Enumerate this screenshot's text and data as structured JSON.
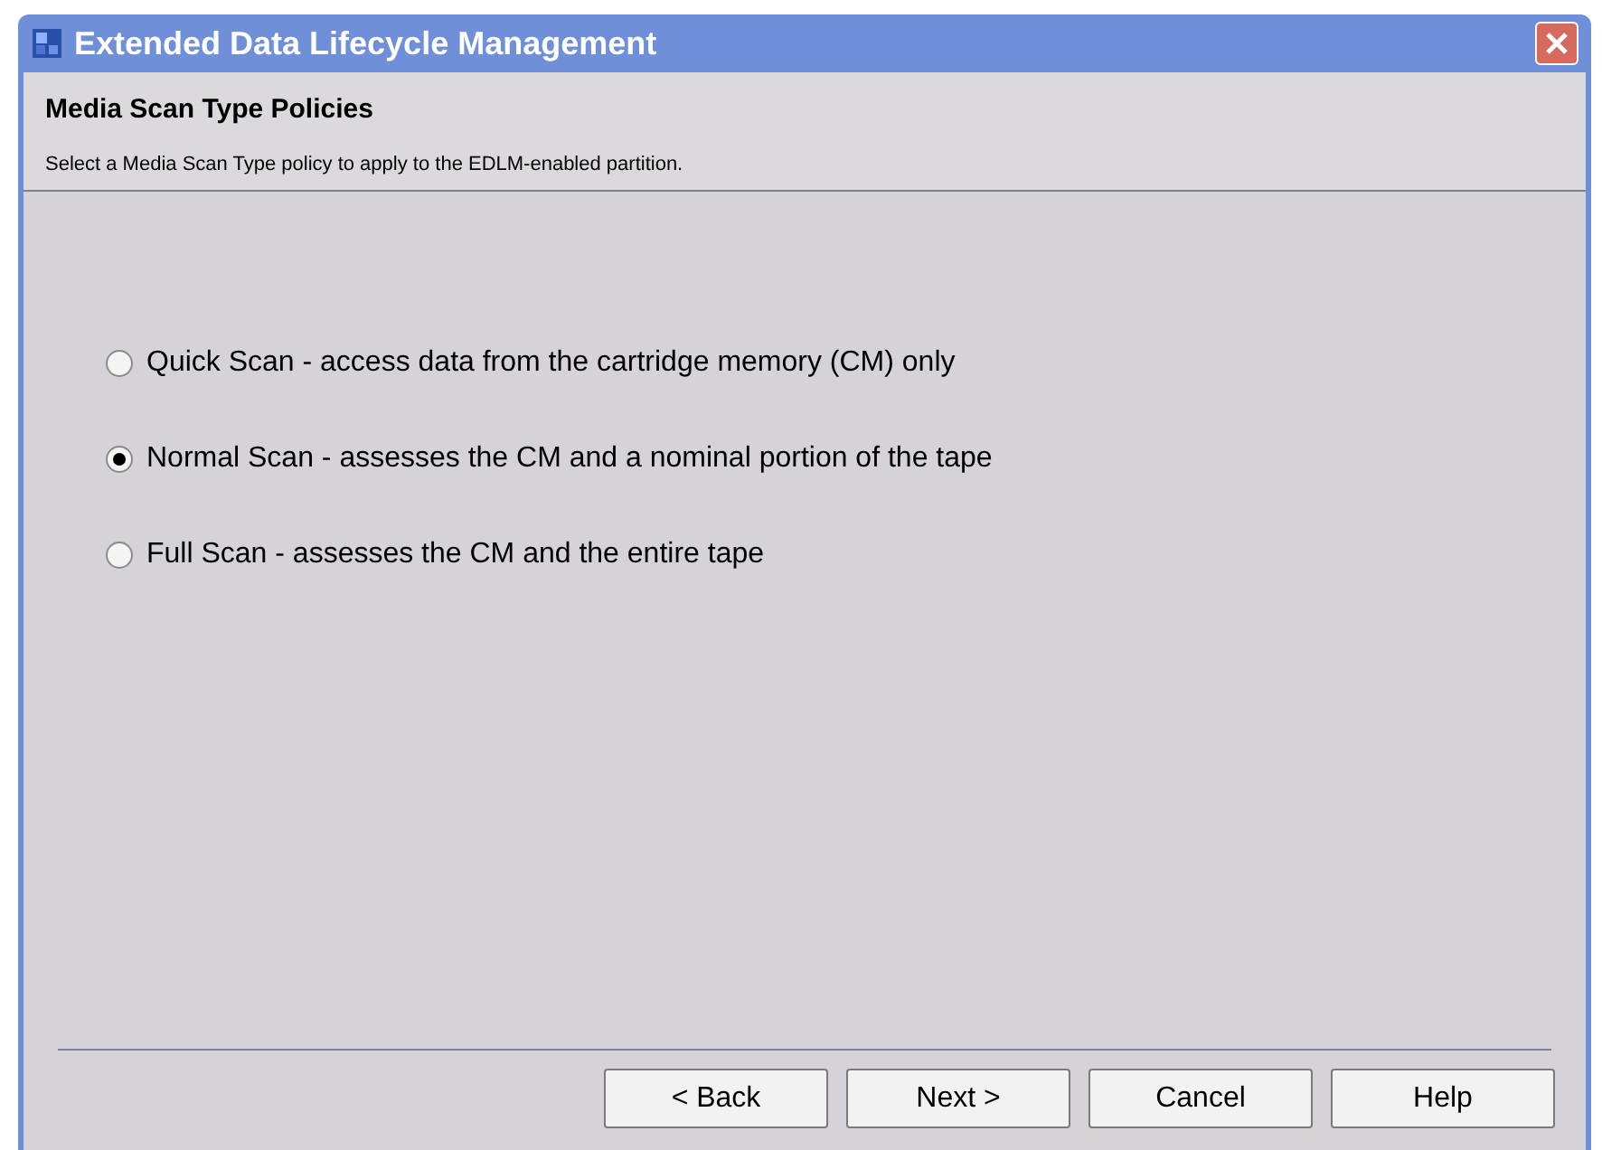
{
  "window": {
    "title": "Extended Data Lifecycle Management"
  },
  "header": {
    "title": "Media Scan Type Policies",
    "description": "Select a Media Scan Type policy to apply to the EDLM-enabled partition."
  },
  "options": [
    {
      "label": "Quick Scan - access data from the cartridge memory (CM) only",
      "selected": false
    },
    {
      "label": "Normal Scan - assesses the CM and a nominal portion of the tape",
      "selected": true
    },
    {
      "label": "Full Scan - assesses the CM and the entire tape",
      "selected": false
    }
  ],
  "buttons": [
    "< Back",
    "Next >",
    "Cancel",
    "Help"
  ]
}
